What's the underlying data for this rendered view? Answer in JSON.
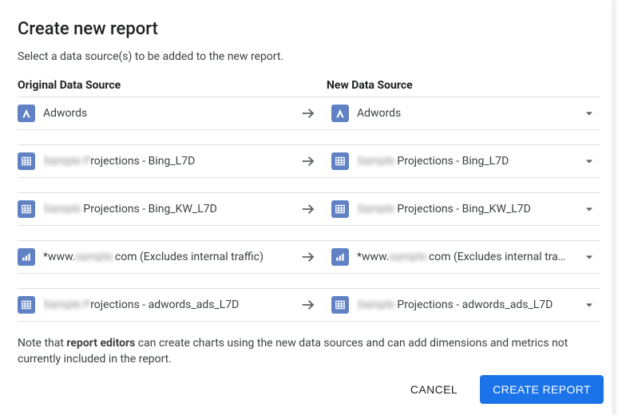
{
  "title": "Create new report",
  "subtitle": "Select a data source(s) to be added to the new report.",
  "columnHeaders": {
    "original": "Original Data Source",
    "new": "New Data Source"
  },
  "rows": [
    {
      "icon": "adwords",
      "original": {
        "prefix": "",
        "obscured": "",
        "suffix": "Adwords"
      },
      "new": {
        "prefix": "",
        "obscured": "",
        "suffix": "Adwords"
      }
    },
    {
      "icon": "sheet",
      "original": {
        "prefix": "",
        "obscured": "Sample P",
        "suffix": "rojections - Bing_L7D"
      },
      "new": {
        "prefix": "",
        "obscured": "Sample",
        "suffix": " Projections - Bing_L7D"
      }
    },
    {
      "icon": "sheet",
      "original": {
        "prefix": "",
        "obscured": "Sample",
        "suffix": " Projections - Bing_KW_L7D"
      },
      "new": {
        "prefix": "",
        "obscured": "Sample",
        "suffix": " Projections - Bing_KW_L7D"
      }
    },
    {
      "icon": "analytics",
      "original": {
        "prefix": "*www.",
        "obscured": "sample.",
        "suffix": "com (Excludes internal traffic)"
      },
      "new": {
        "prefix": "*www.",
        "obscured": "sample.",
        "suffix": "com (Excludes internal traffic)"
      }
    },
    {
      "icon": "sheet",
      "original": {
        "prefix": "",
        "obscured": "Sample P",
        "suffix": "rojections - adwords_ads_L7D"
      },
      "new": {
        "prefix": "",
        "obscured": "Sample",
        "suffix": " Projections - adwords_ads_L7D"
      }
    }
  ],
  "footnote": {
    "pre": "Note that ",
    "bold": "report editors",
    "post": " can create charts using the new data sources and can add dimensions and metrics not currently included in the report."
  },
  "buttons": {
    "cancel": "CANCEL",
    "create": "CREATE REPORT"
  }
}
